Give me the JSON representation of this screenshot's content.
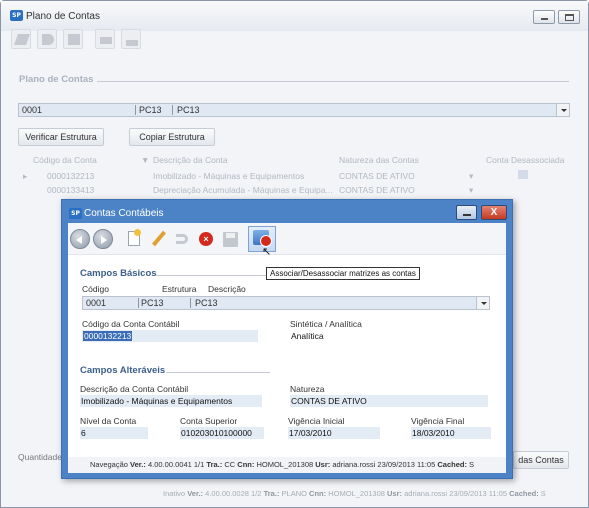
{
  "window": {
    "title": "Plano de Contas",
    "icon_label": "SP"
  },
  "toolbar": {
    "icons": [
      "new-icon",
      "undo-icon",
      "save-icon",
      "export-icon",
      "hierarchy-icon"
    ]
  },
  "plano": {
    "section_title": "Plano de Contas",
    "code_value": "0001",
    "estrutura_value": "PC13",
    "descricao_value": "PC13"
  },
  "buttons": {
    "verificar": "Verificar Estrutura",
    "copiar": "Copiar Estrutura",
    "contas": "das Contas"
  },
  "grid": {
    "columns": [
      "Código da Conta",
      "Descrição da Conta",
      "Natureza das Contas",
      "Conta Desassociada"
    ],
    "rows": [
      {
        "codigo": "0000132213",
        "descricao": "Imobilizado - Máquinas e Equipamentos",
        "natureza": "CONTAS DE ATIVO"
      },
      {
        "codigo": "0000133413",
        "descricao": "Depreciação Acumulada - Máquinas e Equipa...",
        "natureza": "CONTAS DE ATIVO"
      }
    ]
  },
  "footer": {
    "quantidade": "Quantidade",
    "status_state": "Inativo",
    "version_label": "Ver.:",
    "version": "4.00.00.0028",
    "page": "1/2",
    "tra_label": "Tra.:",
    "tra": "PLANO",
    "cnn_label": "Cnn:",
    "cnn": "HOMOL_201308",
    "usr_label": "Usr:",
    "usr": "adriana.rossi",
    "datetime": "23/09/2013 11:05",
    "cached_label": "Cached:",
    "cached": "S"
  },
  "dialog": {
    "title": "Contas Contábeis",
    "icon_label": "SP",
    "close_label": "X",
    "tooltip": "Associar/Desassociar matrizes as contas",
    "basicos": {
      "section_title": "Campos Básicos",
      "codigo_label": "Código",
      "estrutura_label": "Estrutura",
      "descricao_label": "Descrição",
      "codigo_value": "0001",
      "estrutura_value": "PC13",
      "descricao_value": "PC13",
      "conta_contabil_label": "Código da Conta Contábil",
      "conta_contabil_value": "0000132213",
      "sintetica_label": "Sintética / Analítica",
      "sintetica_value": "Analítica"
    },
    "alteraveis": {
      "section_title": "Campos Alteráveis",
      "descricao_label": "Descrição da Conta Contábil",
      "descricao_value": "Imobilizado - Máquinas e Equipamentos",
      "natureza_label": "Natureza",
      "natureza_value": "CONTAS DE ATIVO",
      "nivel_label": "Nível da Conta",
      "nivel_value": "6",
      "superior_label": "Conta Superior",
      "superior_value": "010203010100000",
      "vig_ini_label": "Vigência Inicial",
      "vig_ini_value": "17/03/2010",
      "vig_fim_label": "Vigência Final",
      "vig_fim_value": "18/03/2010"
    },
    "status": {
      "nav_label": "Navegação",
      "version_label": "Ver.:",
      "version": "4.00.00.0041",
      "page": "1/1",
      "tra_label": "Tra.:",
      "tra": "CC",
      "cnn_label": "Cnn:",
      "cnn": "HOMOL_201308",
      "usr_label": "Usr:",
      "usr": "adriana.rossi",
      "datetime": "23/09/2013 11:05",
      "cached_label": "Cached:",
      "cached": "S"
    }
  },
  "colors": {
    "dialog_frame": "#4c83c6",
    "field_bg": "#e3ebf5",
    "section_blue": "#3c5e8c",
    "close_red": "#c43a22"
  }
}
